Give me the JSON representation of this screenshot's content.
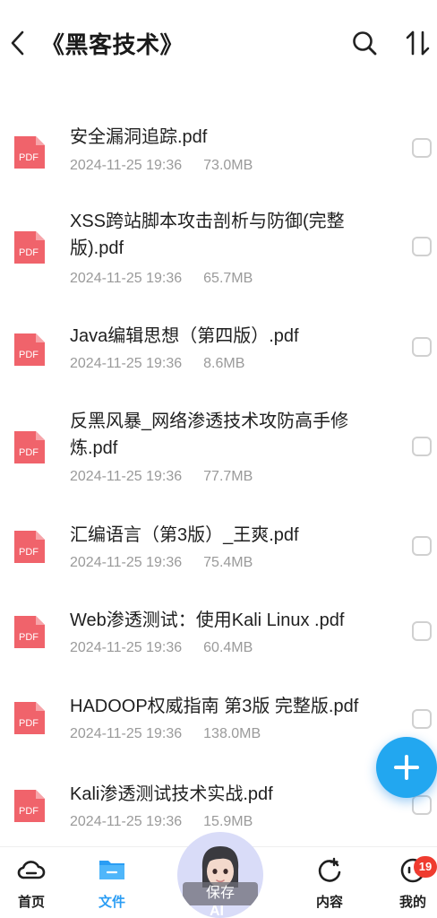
{
  "header": {
    "title": "《黑客技术》"
  },
  "files": [
    {
      "name": "安全漏洞追踪.pdf",
      "date": "2024-11-25 19:36",
      "size": "73.0MB",
      "icon": "PDF"
    },
    {
      "name": "XSS跨站脚本攻击剖析与防御(完整版).pdf",
      "date": "2024-11-25 19:36",
      "size": "65.7MB",
      "icon": "PDF"
    },
    {
      "name": "Java编辑思想（第四版）.pdf",
      "date": "2024-11-25 19:36",
      "size": "8.6MB",
      "icon": "PDF"
    },
    {
      "name": "反黑风暴_网络渗透技术攻防高手修炼.pdf",
      "date": "2024-11-25 19:36",
      "size": "77.7MB",
      "icon": "PDF"
    },
    {
      "name": "汇编语言（第3版）_王爽.pdf",
      "date": "2024-11-25 19:36",
      "size": "75.4MB",
      "icon": "PDF"
    },
    {
      "name": "Web渗透测试：使用Kali Linux .pdf",
      "date": "2024-11-25 19:36",
      "size": "60.4MB",
      "icon": "PDF"
    },
    {
      "name": "HADOOP权威指南 第3版 完整版.pdf",
      "date": "2024-11-25 19:36",
      "size": "138.0MB",
      "icon": "PDF"
    },
    {
      "name": "Kali渗透测试技术实战.pdf",
      "date": "2024-11-25 19:36",
      "size": "15.9MB",
      "icon": "PDF"
    }
  ],
  "bottom_nav": {
    "home": "首页",
    "files": "文件",
    "ai_save": "保存",
    "ai_label": "AI",
    "content": "内容",
    "mine": "我的",
    "badge": "19"
  },
  "colors": {
    "accent": "#2a9df4",
    "pdf": "#f0636b",
    "badge": "#ef3b2f"
  }
}
